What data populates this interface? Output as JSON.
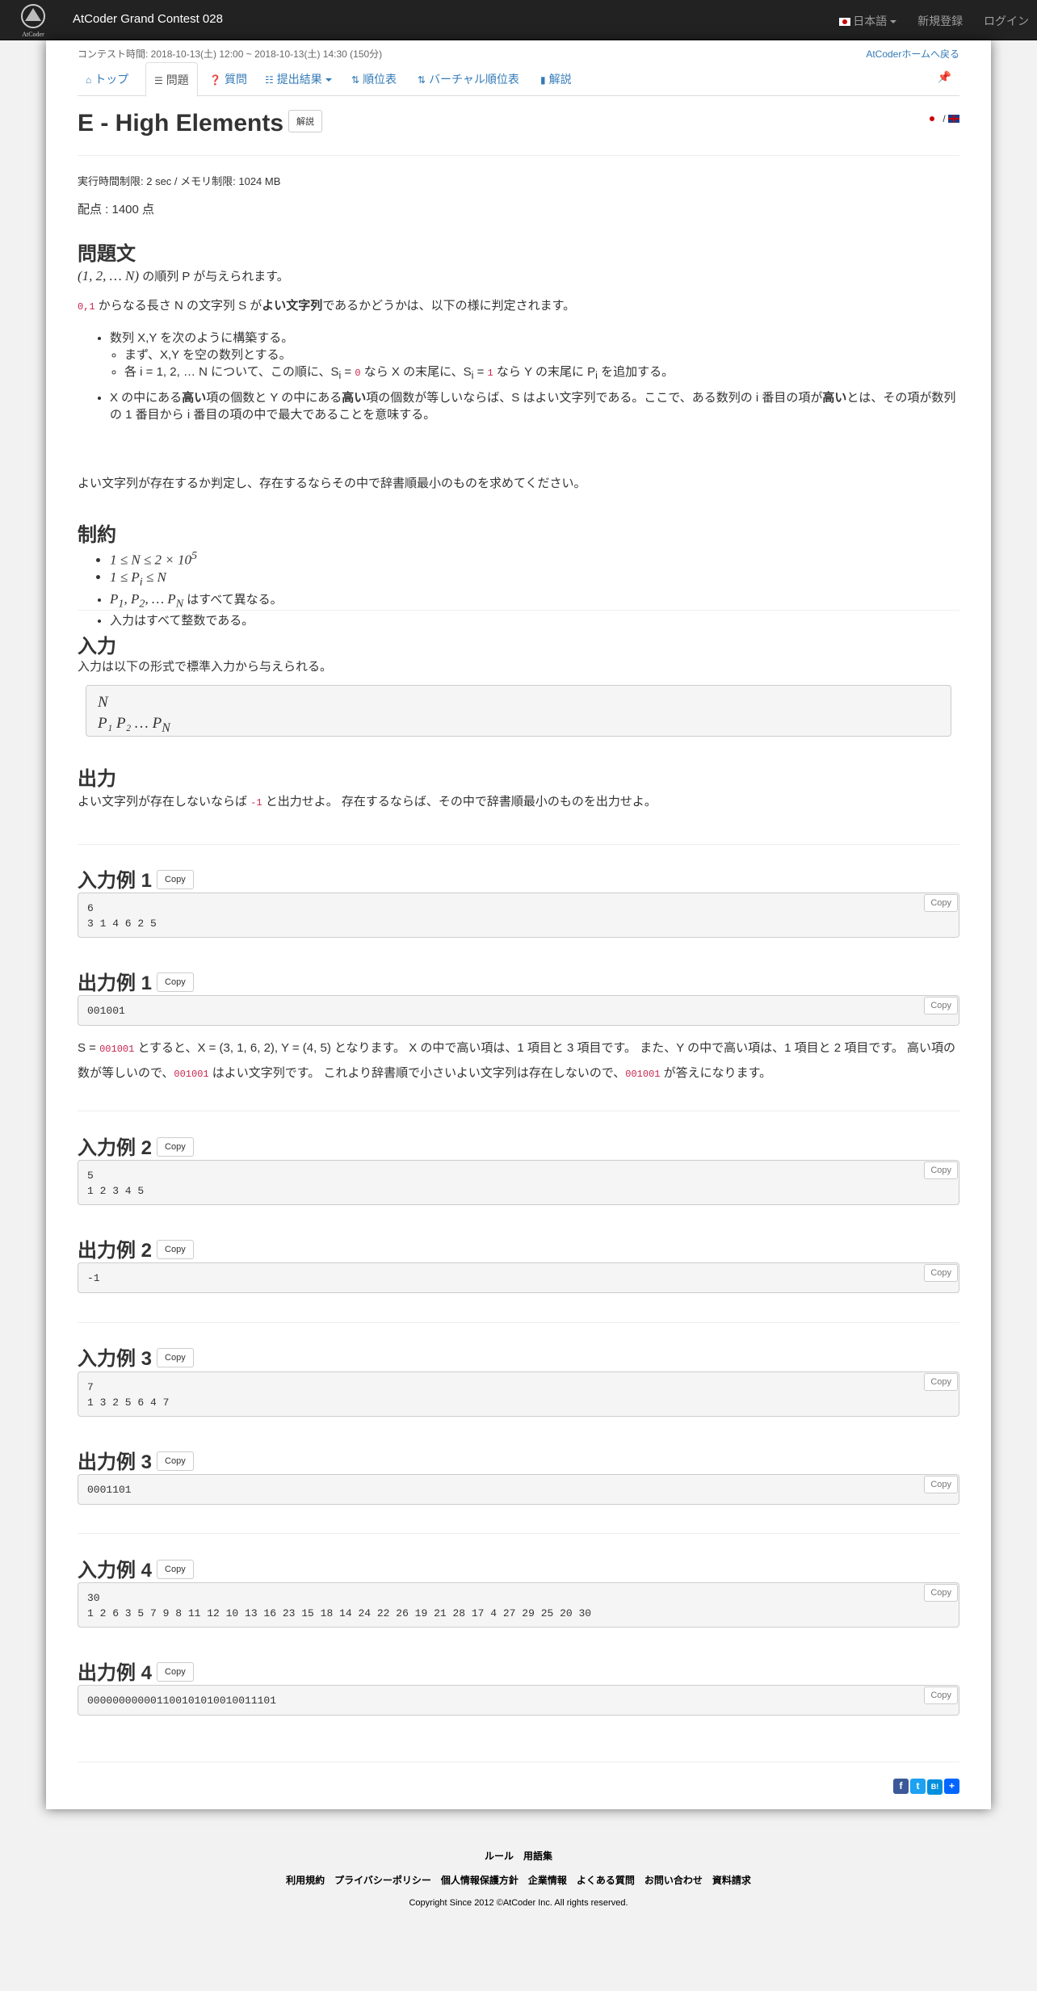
{
  "navbar": {
    "brand": "AtCoder Grand Contest 028",
    "logo_caption": "AtCoder",
    "language": "日本語",
    "signup": "新規登録",
    "login": "ログイン"
  },
  "contest": {
    "time_label": "コンテスト時間: 2018-10-13(土) 12:00 ~ 2018-10-13(土) 14:30 (150分)",
    "back_home": "AtCoderホームへ戻る"
  },
  "tabs": [
    {
      "label": "トップ",
      "icon": "home-icon"
    },
    {
      "label": "問題",
      "icon": "list-icon"
    },
    {
      "label": "質問",
      "icon": "question-icon"
    },
    {
      "label": "提出結果",
      "icon": "table-icon"
    },
    {
      "label": "順位表",
      "icon": "sort-icon"
    },
    {
      "label": "バーチャル順位表",
      "icon": "sort-icon"
    },
    {
      "label": "解説",
      "icon": "book-icon"
    }
  ],
  "problem": {
    "title": "E - High Elements",
    "editorial_button": "解説",
    "limits": "実行時間制限: 2 sec / メモリ制限: 1024 MB",
    "score": "配点 : 1400 点"
  },
  "statement": {
    "heading": "問題文",
    "p1_math": "(1, 2, … N)",
    "p1_text": " の順列 P が与えられます。",
    "p2_code": "0,1",
    "p2_text_a": " からなる長さ N の文字列 S が",
    "p2_bold": "よい文字列",
    "p2_text_b": "であるかどうかは、以下の様に判定されます。",
    "li1": "数列 X,Y を次のように構築する。",
    "li1a": "まず、X,Y を空の数列とする。",
    "li1b_a": "各 i = 1, 2, … N について、この順に、S",
    "li1b_code0": "0",
    "li1b_b": " なら X の末尾に、S",
    "li1b_code1": "1",
    "li1b_c": " なら Y の末尾に P",
    "li1b_d": " を追加する。",
    "li2_a": "X の中にある",
    "li2_b1": "高い",
    "li2_c": "項の個数と Y の中にある",
    "li2_b2": "高い",
    "li2_d": "項の個数が等しいならば、S はよい文字列である。ここで、ある数列の i 番目の項が",
    "li2_b3": "高い",
    "li2_e": "とは、その項が数列の 1 番目から i 番目の項の中で最大であることを意味する。",
    "p3": "よい文字列が存在するか判定し、存在するならその中で辞書順最小のものを求めてください。"
  },
  "constraints": {
    "heading": "制約",
    "items": [
      "1 ≤ N ≤ 2 × 10",
      "1 ≤ P",
      "P",
      "入力はすべて整数である。"
    ],
    "item3_text": " はすべて異なる。"
  },
  "input": {
    "heading": "入力",
    "desc": "入力は以下の形式で標準入力から与えられる。",
    "line1": "N",
    "line2": "P₁   P₂   …   P"
  },
  "output": {
    "heading": "出力",
    "desc_a": "よい文字列が存在しないならば ",
    "code": "-1",
    "desc_b": " と出力せよ。 存在するならば、その中で辞書順最小のものを出力せよ。"
  },
  "copy_label": "Copy",
  "samples": [
    {
      "in_heading": "入力例 1",
      "in": "6\n3 1 4 6 2 5",
      "out_heading": "出力例 1",
      "out": "001001"
    },
    {
      "in_heading": "入力例 2",
      "in": "5\n1 2 3 4 5",
      "out_heading": "出力例 2",
      "out": "-1"
    },
    {
      "in_heading": "入力例 3",
      "in": "7\n1 3 2 5 6 4 7",
      "out_heading": "出力例 3",
      "out": "0001101"
    },
    {
      "in_heading": "入力例 4",
      "in": "30\n1 2 6 3 5 7 9 8 11 12 10 13 16 23 15 18 14 24 22 26 19 21 28 17 4 27 29 25 20 30",
      "out_heading": "出力例 4",
      "out": "000000000001100101010010011101"
    }
  ],
  "explanation": {
    "a": "S = ",
    "code1": "001001",
    "b": " とすると、X = (3, 1, 6, 2), Y = (4, 5) となります。 X の中で高い項は、1 項目と 3 項目です。 また、Y の中で高い項は、1 項目と 2 項目です。 高い項の数が等しいので、",
    "code2": "001001",
    "c": " はよい文字列です。 これより辞書順で小さいよい文字列は存在しないので、",
    "code3": "001001",
    "d": " が答えになります。"
  },
  "footer": {
    "row1": [
      "ルール",
      "用語集"
    ],
    "row2": [
      "利用規約",
      "プライバシーポリシー",
      "個人情報保護方針",
      "企業情報",
      "よくある質問",
      "お問い合わせ",
      "資料請求"
    ],
    "copyright": "Copyright Since 2012 ©AtCoder Inc. All rights reserved."
  }
}
